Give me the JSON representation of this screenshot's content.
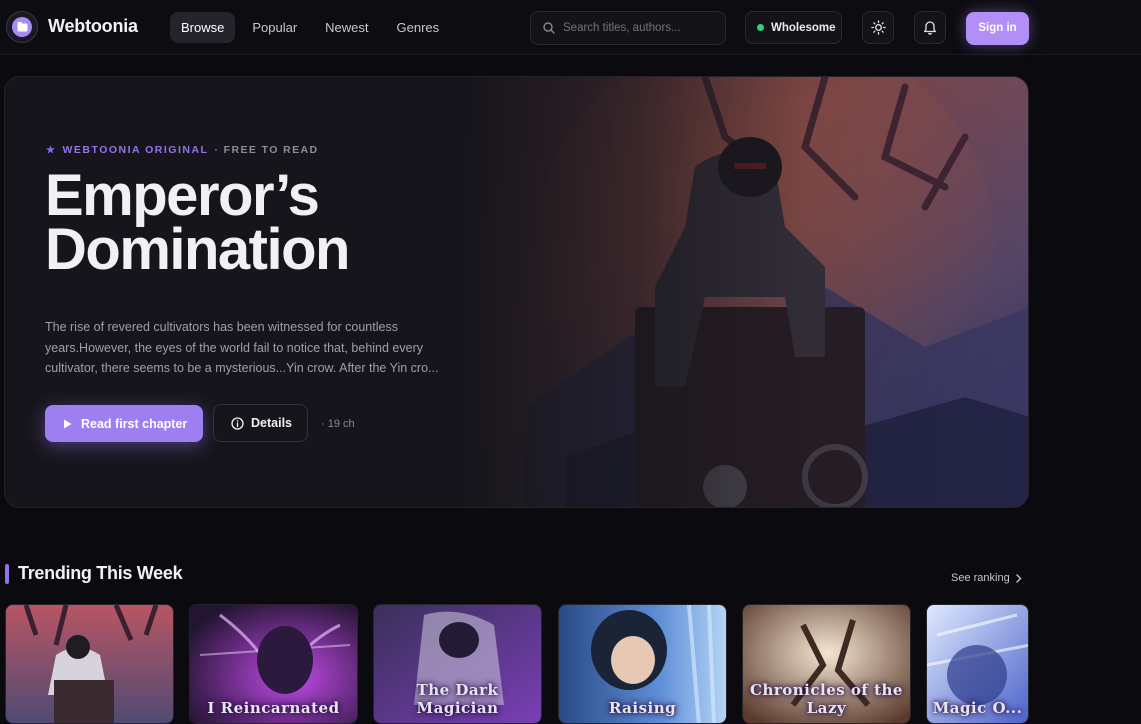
{
  "header": {
    "brand": "Webtoonia",
    "nav": [
      "Browse",
      "Popular",
      "Newest",
      "Genres"
    ],
    "search_placeholder": "Search titles, authors...",
    "filter_label": "Wholesome",
    "signin_label": "Sign in"
  },
  "hero": {
    "eyebrow_original": "WEBTOONIA ORIGINAL",
    "eyebrow_free": "· FREE TO READ",
    "title_line1": "Emperor’s",
    "title_line2": "Domination",
    "description": "The rise of revered cultivators has been witnessed for countless years.However, the eyes of the world fail to notice that, behind every cultivator, there seems to be a mysterious...Yin crow. After the Yin cro...",
    "read_label": "Read first chapter",
    "details_label": "Details",
    "chapter_count": "· 19 ch"
  },
  "trending": {
    "title": "Trending This Week",
    "see_all": "See ranking",
    "covers": [
      {
        "caption": ""
      },
      {
        "caption": "I Reincarnated"
      },
      {
        "caption": "The Dark Magician"
      },
      {
        "caption": "Raising"
      },
      {
        "caption": "Chronicles of the Lazy"
      },
      {
        "caption": "Magic O..."
      }
    ]
  },
  "colors": {
    "accent": "#9e7ff0",
    "accent_light": "#b18ff7",
    "status_green": "#31d17a",
    "background": "#0b0a0e"
  },
  "icons": [
    "logo-icon",
    "search-icon",
    "sun-icon",
    "bell-icon",
    "play-icon",
    "info-icon",
    "chevron-right-icon"
  ]
}
